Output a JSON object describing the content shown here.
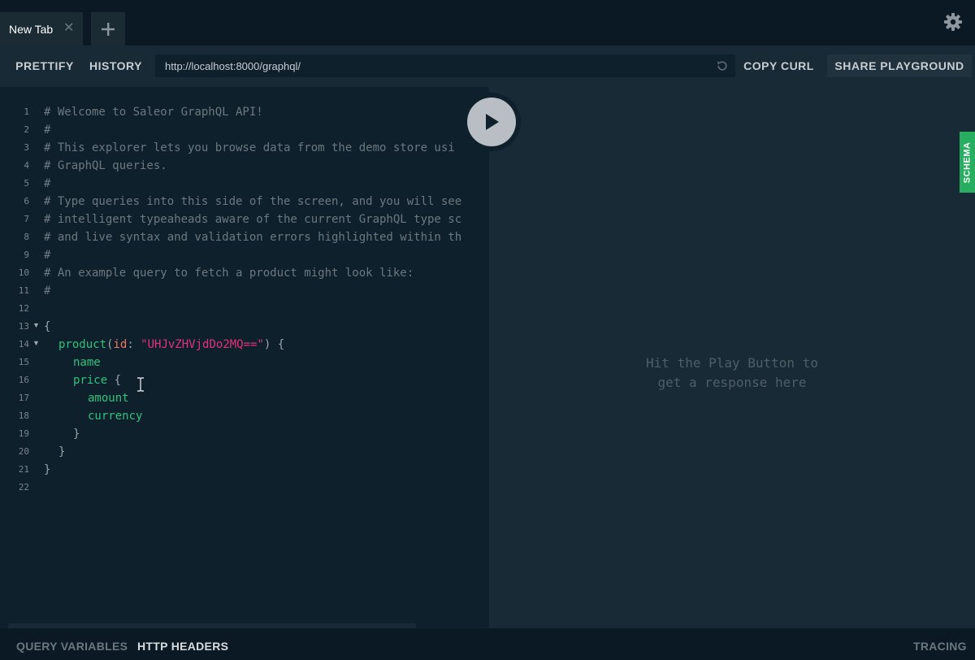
{
  "tabs": [
    {
      "label": "New Tab",
      "active": true
    }
  ],
  "toolbar": {
    "prettify_label": "PRETTIFY",
    "history_label": "HISTORY",
    "endpoint_url": "http://localhost:8000/graphql/",
    "copy_curl_label": "COPY CURL",
    "share_label": "SHARE PLAYGROUND"
  },
  "editor": {
    "lines": [
      {
        "n": "1"
      },
      {
        "n": "2"
      },
      {
        "n": "3"
      },
      {
        "n": "4"
      },
      {
        "n": "5"
      },
      {
        "n": "6"
      },
      {
        "n": "7"
      },
      {
        "n": "8"
      },
      {
        "n": "9"
      },
      {
        "n": "10"
      },
      {
        "n": "11"
      },
      {
        "n": "12"
      },
      {
        "n": "13"
      },
      {
        "n": "14"
      },
      {
        "n": "15"
      },
      {
        "n": "16"
      },
      {
        "n": "17"
      },
      {
        "n": "18"
      },
      {
        "n": "19"
      },
      {
        "n": "20"
      },
      {
        "n": "21"
      },
      {
        "n": "22"
      }
    ],
    "comments": [
      "# Welcome to Saleor GraphQL API!",
      "#",
      "# This explorer lets you browse data from the demo store usi",
      "# GraphQL queries.",
      "#",
      "# Type queries into this side of the screen, and you will see",
      "# intelligent typeaheads aware of the current GraphQL type sc",
      "# and live syntax and validation errors highlighted within th",
      "#",
      "# An example query to fetch a product might look like:",
      "#"
    ],
    "query": {
      "open_brace": "{",
      "root_field": "product",
      "paren_open": "(",
      "arg_name": "id",
      "arg_colon": ": ",
      "arg_value": "\"UHJvZHVjdDo2MQ==\"",
      "paren_close_brace": ") {",
      "f_name": "name",
      "f_price": "price",
      "f_price_brace": " {",
      "f_amount": "amount",
      "f_currency": "currency",
      "close_inner": "}",
      "close_product": "}",
      "close_root": "}"
    }
  },
  "result": {
    "hint_line1": "Hit the Play Button to",
    "hint_line2": "get a response here"
  },
  "schema_tab_label": "SCHEMA",
  "bottom": {
    "query_variables_label": "QUERY VARIABLES",
    "http_headers_label": "HTTP HEADERS",
    "tracing_label": "TRACING"
  },
  "colors": {
    "field": "#2fc27a",
    "argument": "#f0785a",
    "string": "#e4327a",
    "schema_accent": "#27ae60"
  }
}
